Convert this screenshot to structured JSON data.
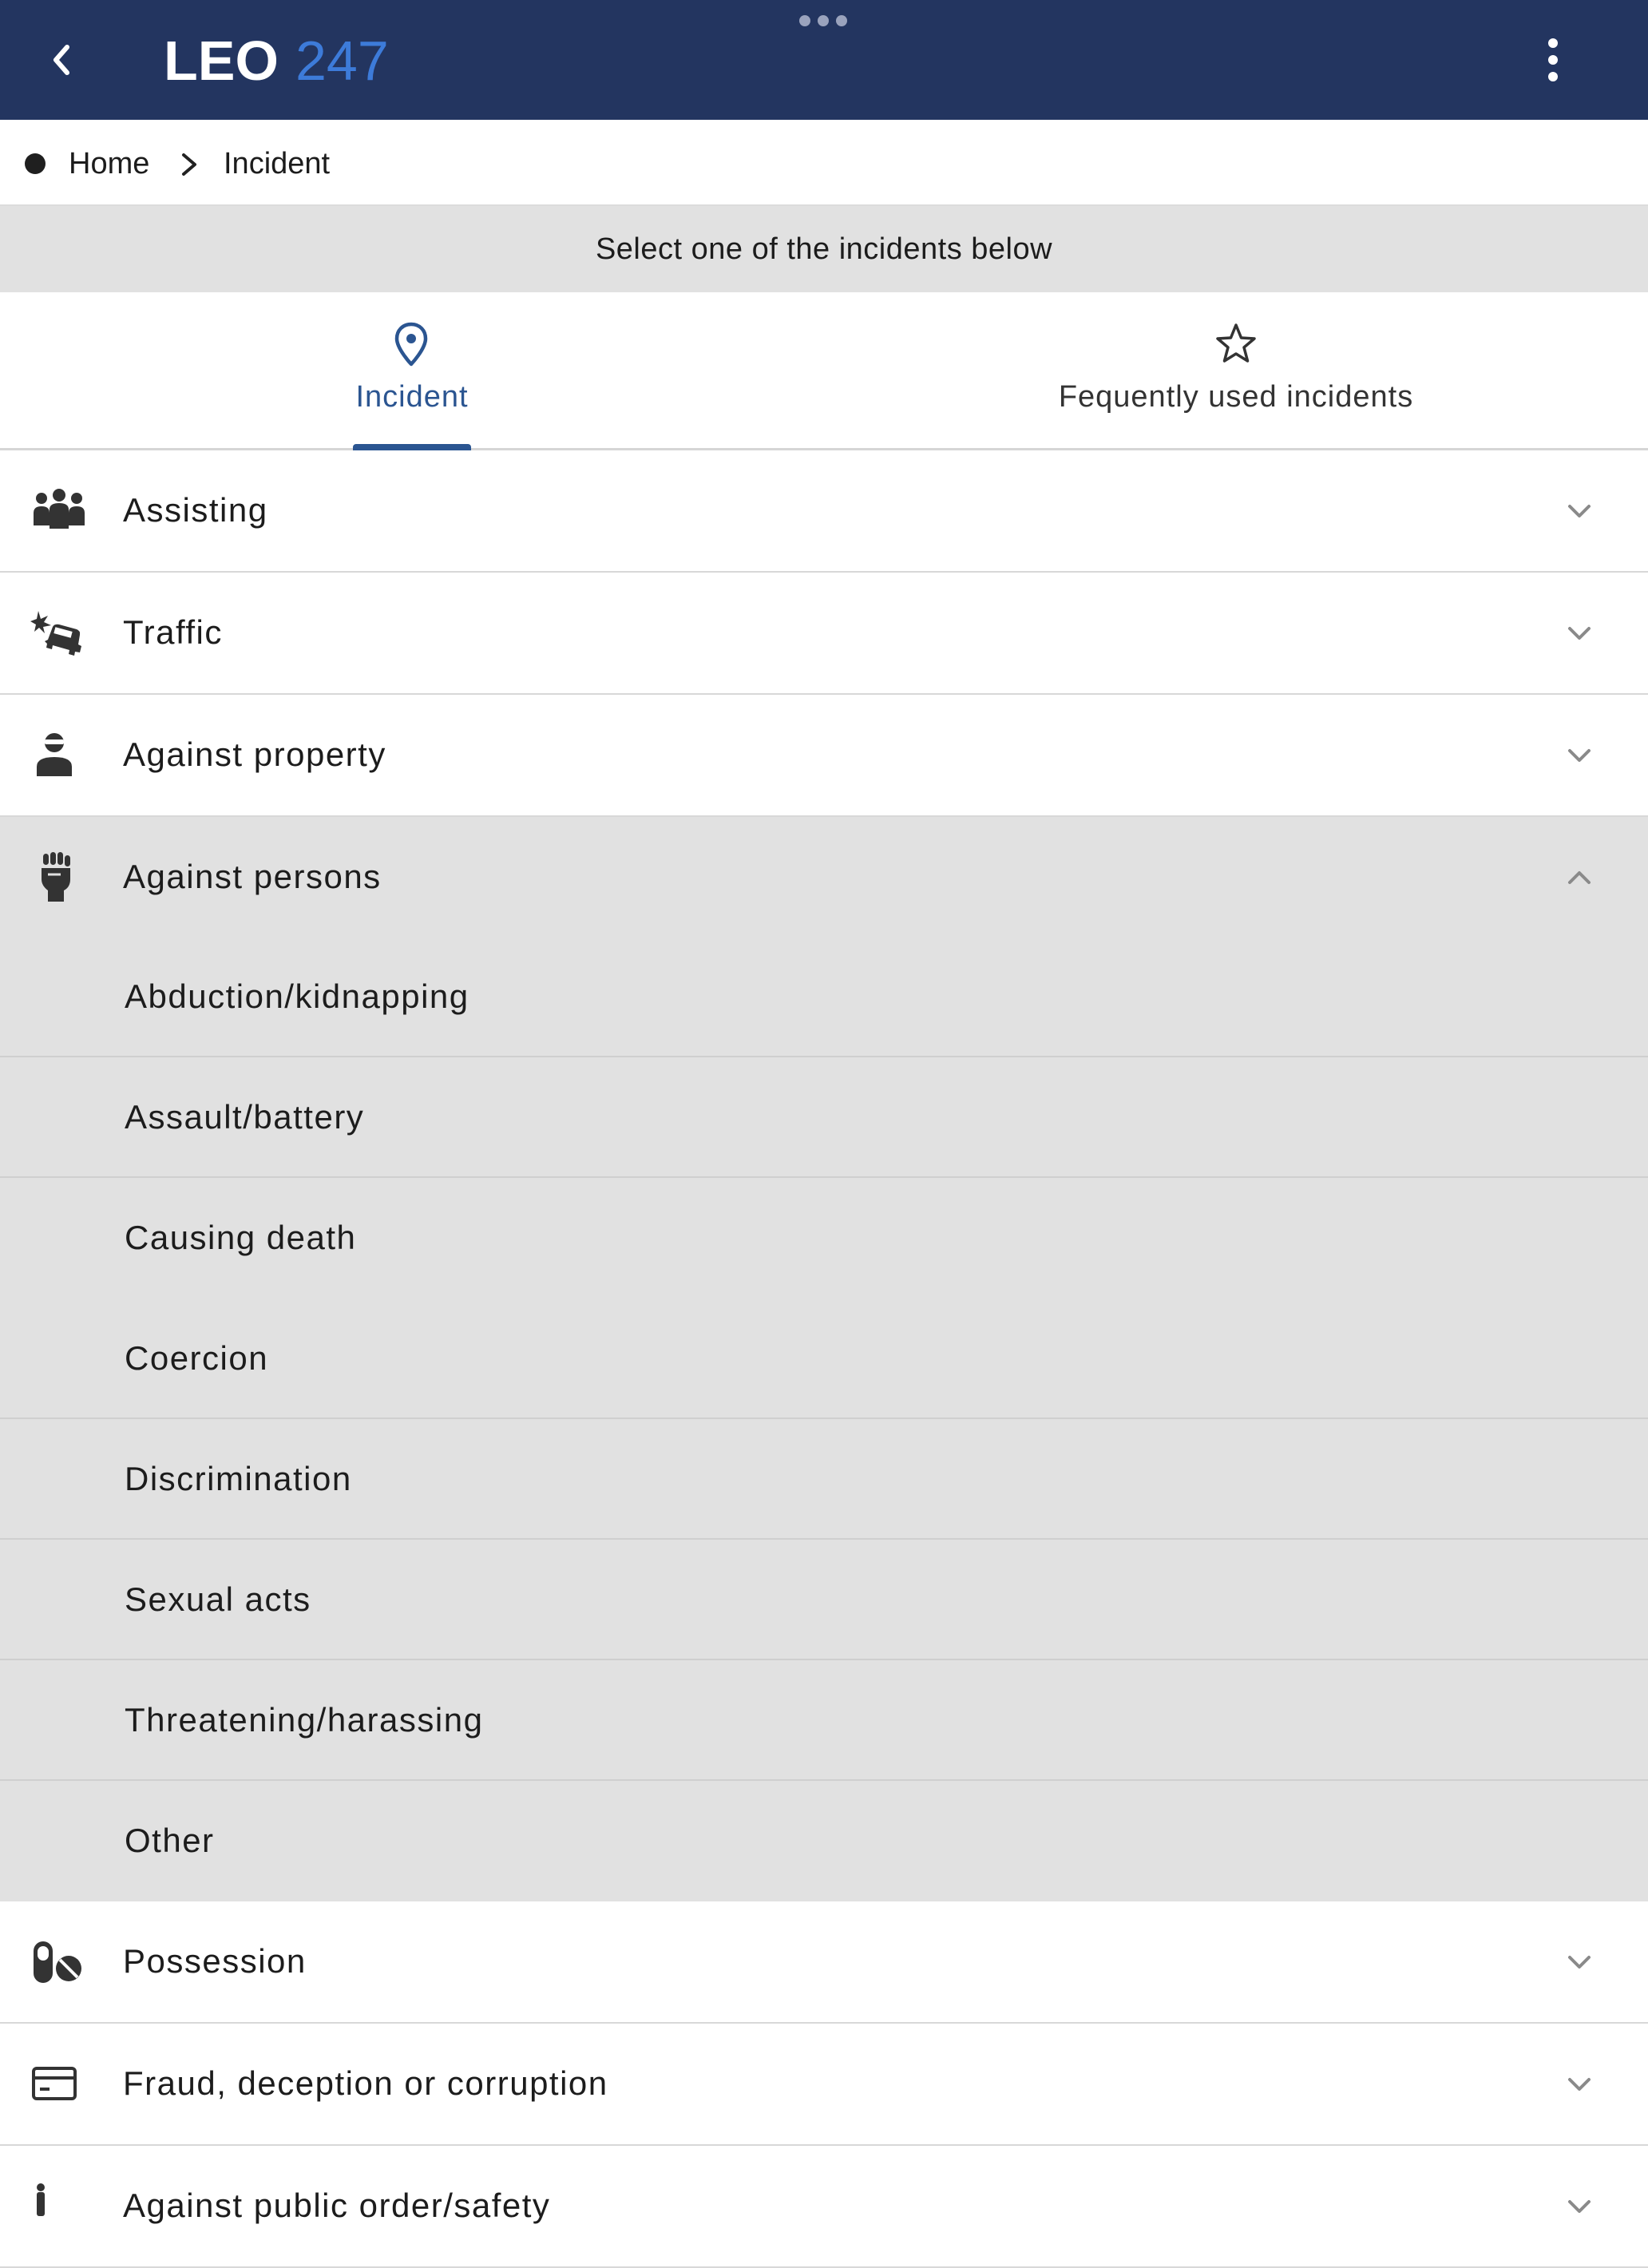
{
  "header": {
    "logo_main": "LEO",
    "logo_accent": "247",
    "colors": {
      "bar": "#233560",
      "accent_blue": "#3d7bd9",
      "accent_yellow": "#e8b93a"
    }
  },
  "breadcrumb": {
    "home": "Home",
    "current": "Incident"
  },
  "banner": {
    "text": "Select one of the incidents below"
  },
  "tabs": [
    {
      "label": "Incident",
      "icon": "map-pin-icon",
      "active": true
    },
    {
      "label": "Fequently used incidents",
      "icon": "star-icon",
      "active": false
    }
  ],
  "categories": [
    {
      "label": "Assisting",
      "icon": "people-group-icon",
      "expanded": false
    },
    {
      "label": "Traffic",
      "icon": "car-crash-icon",
      "expanded": false
    },
    {
      "label": "Against property",
      "icon": "thief-icon",
      "expanded": false
    },
    {
      "label": "Against persons",
      "icon": "fist-icon",
      "expanded": true,
      "items": [
        "Abduction/kidnapping",
        "Assault/battery",
        "Causing death",
        "Coercion",
        "Discrimination",
        "Sexual acts",
        "Threatening/harassing",
        "Other"
      ]
    },
    {
      "label": "Possession",
      "icon": "pills-icon",
      "expanded": false
    },
    {
      "label": "Fraud, deception or corruption",
      "icon": "credit-card-icon",
      "expanded": false
    },
    {
      "label": "Against public order/safety",
      "icon": "public-order-icon",
      "expanded": false
    }
  ],
  "colors": {
    "active_tab": "#2b5591",
    "expanded_bg": "#e1e1e1"
  }
}
